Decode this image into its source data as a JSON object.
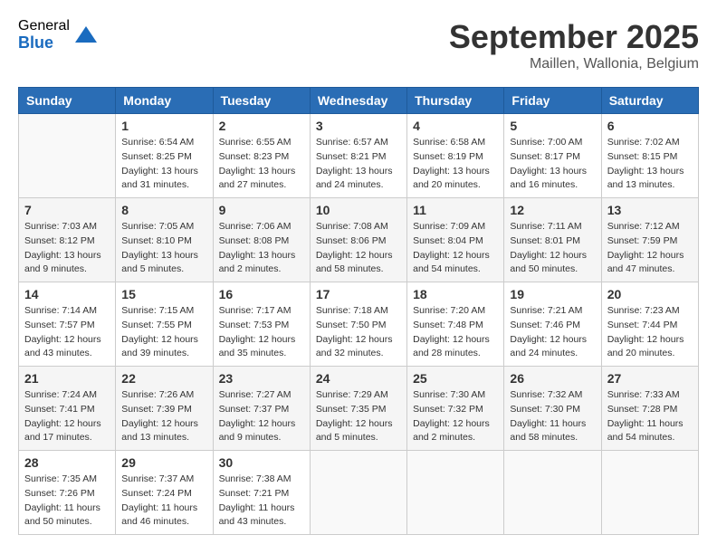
{
  "logo": {
    "general": "General",
    "blue": "Blue"
  },
  "title": "September 2025",
  "subtitle": "Maillen, Wallonia, Belgium",
  "headers": [
    "Sunday",
    "Monday",
    "Tuesday",
    "Wednesday",
    "Thursday",
    "Friday",
    "Saturday"
  ],
  "weeks": [
    [
      {
        "day": "",
        "info": ""
      },
      {
        "day": "1",
        "info": "Sunrise: 6:54 AM\nSunset: 8:25 PM\nDaylight: 13 hours\nand 31 minutes."
      },
      {
        "day": "2",
        "info": "Sunrise: 6:55 AM\nSunset: 8:23 PM\nDaylight: 13 hours\nand 27 minutes."
      },
      {
        "day": "3",
        "info": "Sunrise: 6:57 AM\nSunset: 8:21 PM\nDaylight: 13 hours\nand 24 minutes."
      },
      {
        "day": "4",
        "info": "Sunrise: 6:58 AM\nSunset: 8:19 PM\nDaylight: 13 hours\nand 20 minutes."
      },
      {
        "day": "5",
        "info": "Sunrise: 7:00 AM\nSunset: 8:17 PM\nDaylight: 13 hours\nand 16 minutes."
      },
      {
        "day": "6",
        "info": "Sunrise: 7:02 AM\nSunset: 8:15 PM\nDaylight: 13 hours\nand 13 minutes."
      }
    ],
    [
      {
        "day": "7",
        "info": "Sunrise: 7:03 AM\nSunset: 8:12 PM\nDaylight: 13 hours\nand 9 minutes."
      },
      {
        "day": "8",
        "info": "Sunrise: 7:05 AM\nSunset: 8:10 PM\nDaylight: 13 hours\nand 5 minutes."
      },
      {
        "day": "9",
        "info": "Sunrise: 7:06 AM\nSunset: 8:08 PM\nDaylight: 13 hours\nand 2 minutes."
      },
      {
        "day": "10",
        "info": "Sunrise: 7:08 AM\nSunset: 8:06 PM\nDaylight: 12 hours\nand 58 minutes."
      },
      {
        "day": "11",
        "info": "Sunrise: 7:09 AM\nSunset: 8:04 PM\nDaylight: 12 hours\nand 54 minutes."
      },
      {
        "day": "12",
        "info": "Sunrise: 7:11 AM\nSunset: 8:01 PM\nDaylight: 12 hours\nand 50 minutes."
      },
      {
        "day": "13",
        "info": "Sunrise: 7:12 AM\nSunset: 7:59 PM\nDaylight: 12 hours\nand 47 minutes."
      }
    ],
    [
      {
        "day": "14",
        "info": "Sunrise: 7:14 AM\nSunset: 7:57 PM\nDaylight: 12 hours\nand 43 minutes."
      },
      {
        "day": "15",
        "info": "Sunrise: 7:15 AM\nSunset: 7:55 PM\nDaylight: 12 hours\nand 39 minutes."
      },
      {
        "day": "16",
        "info": "Sunrise: 7:17 AM\nSunset: 7:53 PM\nDaylight: 12 hours\nand 35 minutes."
      },
      {
        "day": "17",
        "info": "Sunrise: 7:18 AM\nSunset: 7:50 PM\nDaylight: 12 hours\nand 32 minutes."
      },
      {
        "day": "18",
        "info": "Sunrise: 7:20 AM\nSunset: 7:48 PM\nDaylight: 12 hours\nand 28 minutes."
      },
      {
        "day": "19",
        "info": "Sunrise: 7:21 AM\nSunset: 7:46 PM\nDaylight: 12 hours\nand 24 minutes."
      },
      {
        "day": "20",
        "info": "Sunrise: 7:23 AM\nSunset: 7:44 PM\nDaylight: 12 hours\nand 20 minutes."
      }
    ],
    [
      {
        "day": "21",
        "info": "Sunrise: 7:24 AM\nSunset: 7:41 PM\nDaylight: 12 hours\nand 17 minutes."
      },
      {
        "day": "22",
        "info": "Sunrise: 7:26 AM\nSunset: 7:39 PM\nDaylight: 12 hours\nand 13 minutes."
      },
      {
        "day": "23",
        "info": "Sunrise: 7:27 AM\nSunset: 7:37 PM\nDaylight: 12 hours\nand 9 minutes."
      },
      {
        "day": "24",
        "info": "Sunrise: 7:29 AM\nSunset: 7:35 PM\nDaylight: 12 hours\nand 5 minutes."
      },
      {
        "day": "25",
        "info": "Sunrise: 7:30 AM\nSunset: 7:32 PM\nDaylight: 12 hours\nand 2 minutes."
      },
      {
        "day": "26",
        "info": "Sunrise: 7:32 AM\nSunset: 7:30 PM\nDaylight: 11 hours\nand 58 minutes."
      },
      {
        "day": "27",
        "info": "Sunrise: 7:33 AM\nSunset: 7:28 PM\nDaylight: 11 hours\nand 54 minutes."
      }
    ],
    [
      {
        "day": "28",
        "info": "Sunrise: 7:35 AM\nSunset: 7:26 PM\nDaylight: 11 hours\nand 50 minutes."
      },
      {
        "day": "29",
        "info": "Sunrise: 7:37 AM\nSunset: 7:24 PM\nDaylight: 11 hours\nand 46 minutes."
      },
      {
        "day": "30",
        "info": "Sunrise: 7:38 AM\nSunset: 7:21 PM\nDaylight: 11 hours\nand 43 minutes."
      },
      {
        "day": "",
        "info": ""
      },
      {
        "day": "",
        "info": ""
      },
      {
        "day": "",
        "info": ""
      },
      {
        "day": "",
        "info": ""
      }
    ]
  ]
}
